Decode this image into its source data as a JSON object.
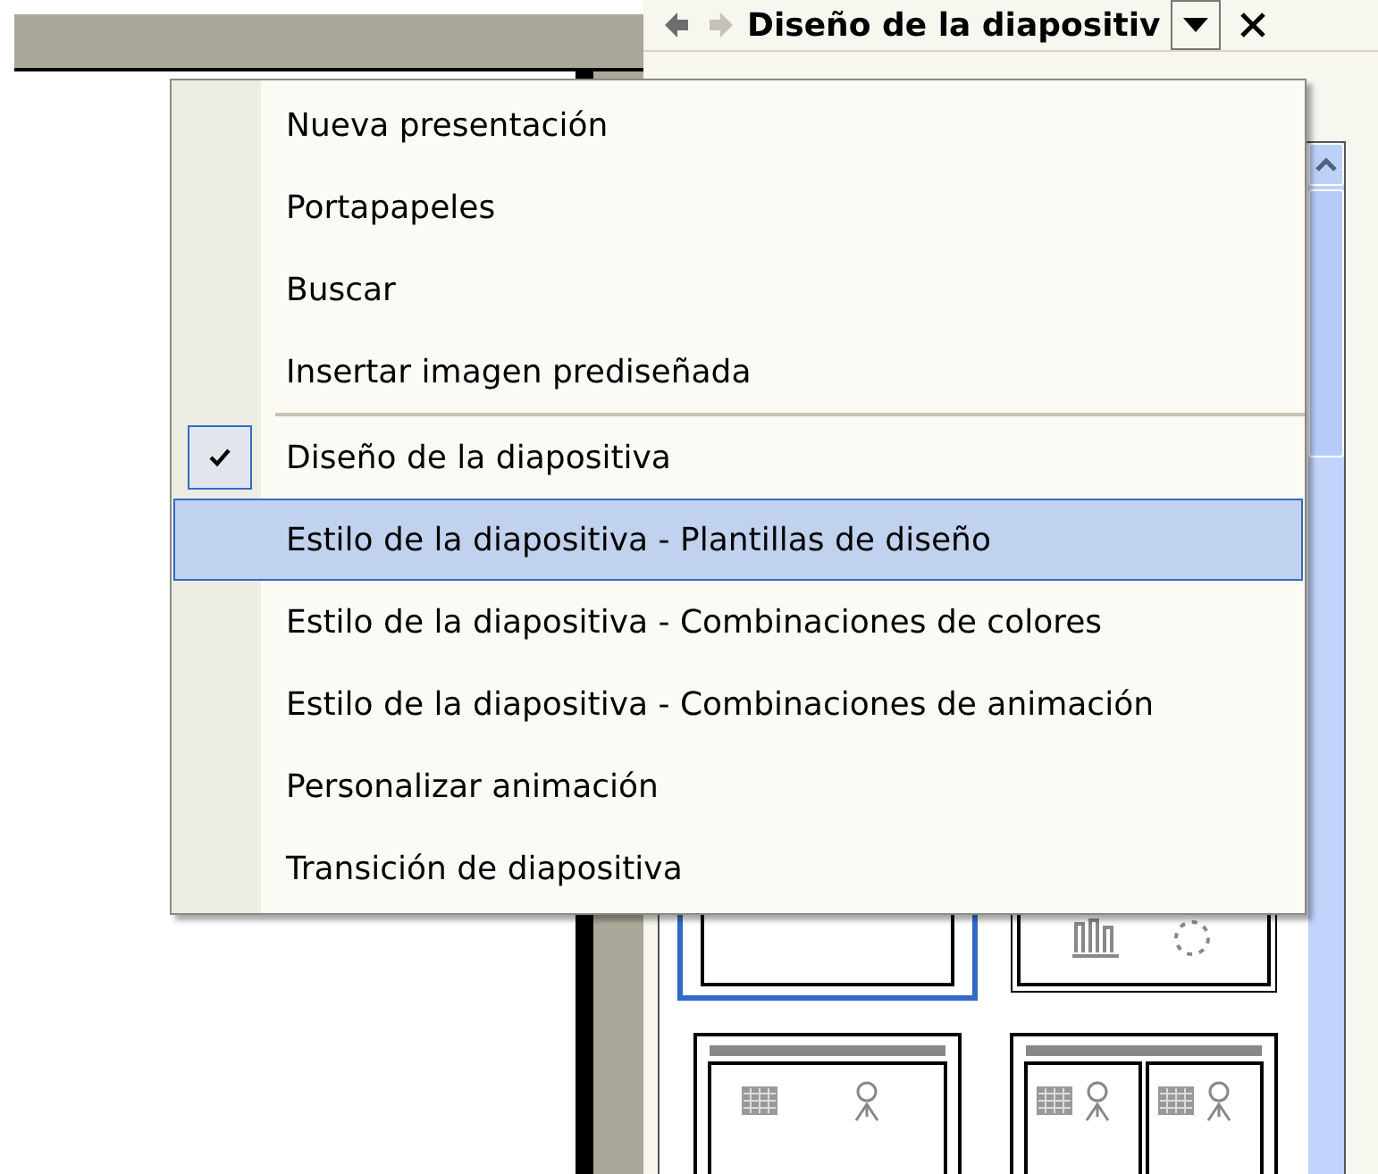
{
  "task_pane": {
    "title": "Diseño de la diapositiv"
  },
  "menu": {
    "items": [
      {
        "kind": "item",
        "label": "Nueva presentación",
        "checked": false,
        "selected": false
      },
      {
        "kind": "item",
        "label": "Portapapeles",
        "checked": false,
        "selected": false
      },
      {
        "kind": "item",
        "label": "Buscar",
        "checked": false,
        "selected": false
      },
      {
        "kind": "item",
        "label": "Insertar imagen prediseñada",
        "checked": false,
        "selected": false
      },
      {
        "kind": "separator"
      },
      {
        "kind": "item",
        "label": "Diseño de la diapositiva",
        "checked": true,
        "selected": false
      },
      {
        "kind": "item",
        "label": "Estilo de la diapositiva - Plantillas de diseño",
        "checked": false,
        "selected": true
      },
      {
        "kind": "item",
        "label": "Estilo de la diapositiva - Combinaciones de colores",
        "checked": false,
        "selected": false
      },
      {
        "kind": "item",
        "label": "Estilo de la diapositiva - Combinaciones de animación",
        "checked": false,
        "selected": false
      },
      {
        "kind": "item",
        "label": "Personalizar animación",
        "checked": false,
        "selected": false
      },
      {
        "kind": "item",
        "label": "Transición de diapositiva",
        "checked": false,
        "selected": false
      }
    ]
  },
  "layouts": [
    {
      "kind": "blank",
      "selected": true
    },
    {
      "kind": "chart",
      "selected": false
    },
    {
      "kind": "table",
      "selected": false
    },
    {
      "kind": "double",
      "selected": false
    }
  ]
}
